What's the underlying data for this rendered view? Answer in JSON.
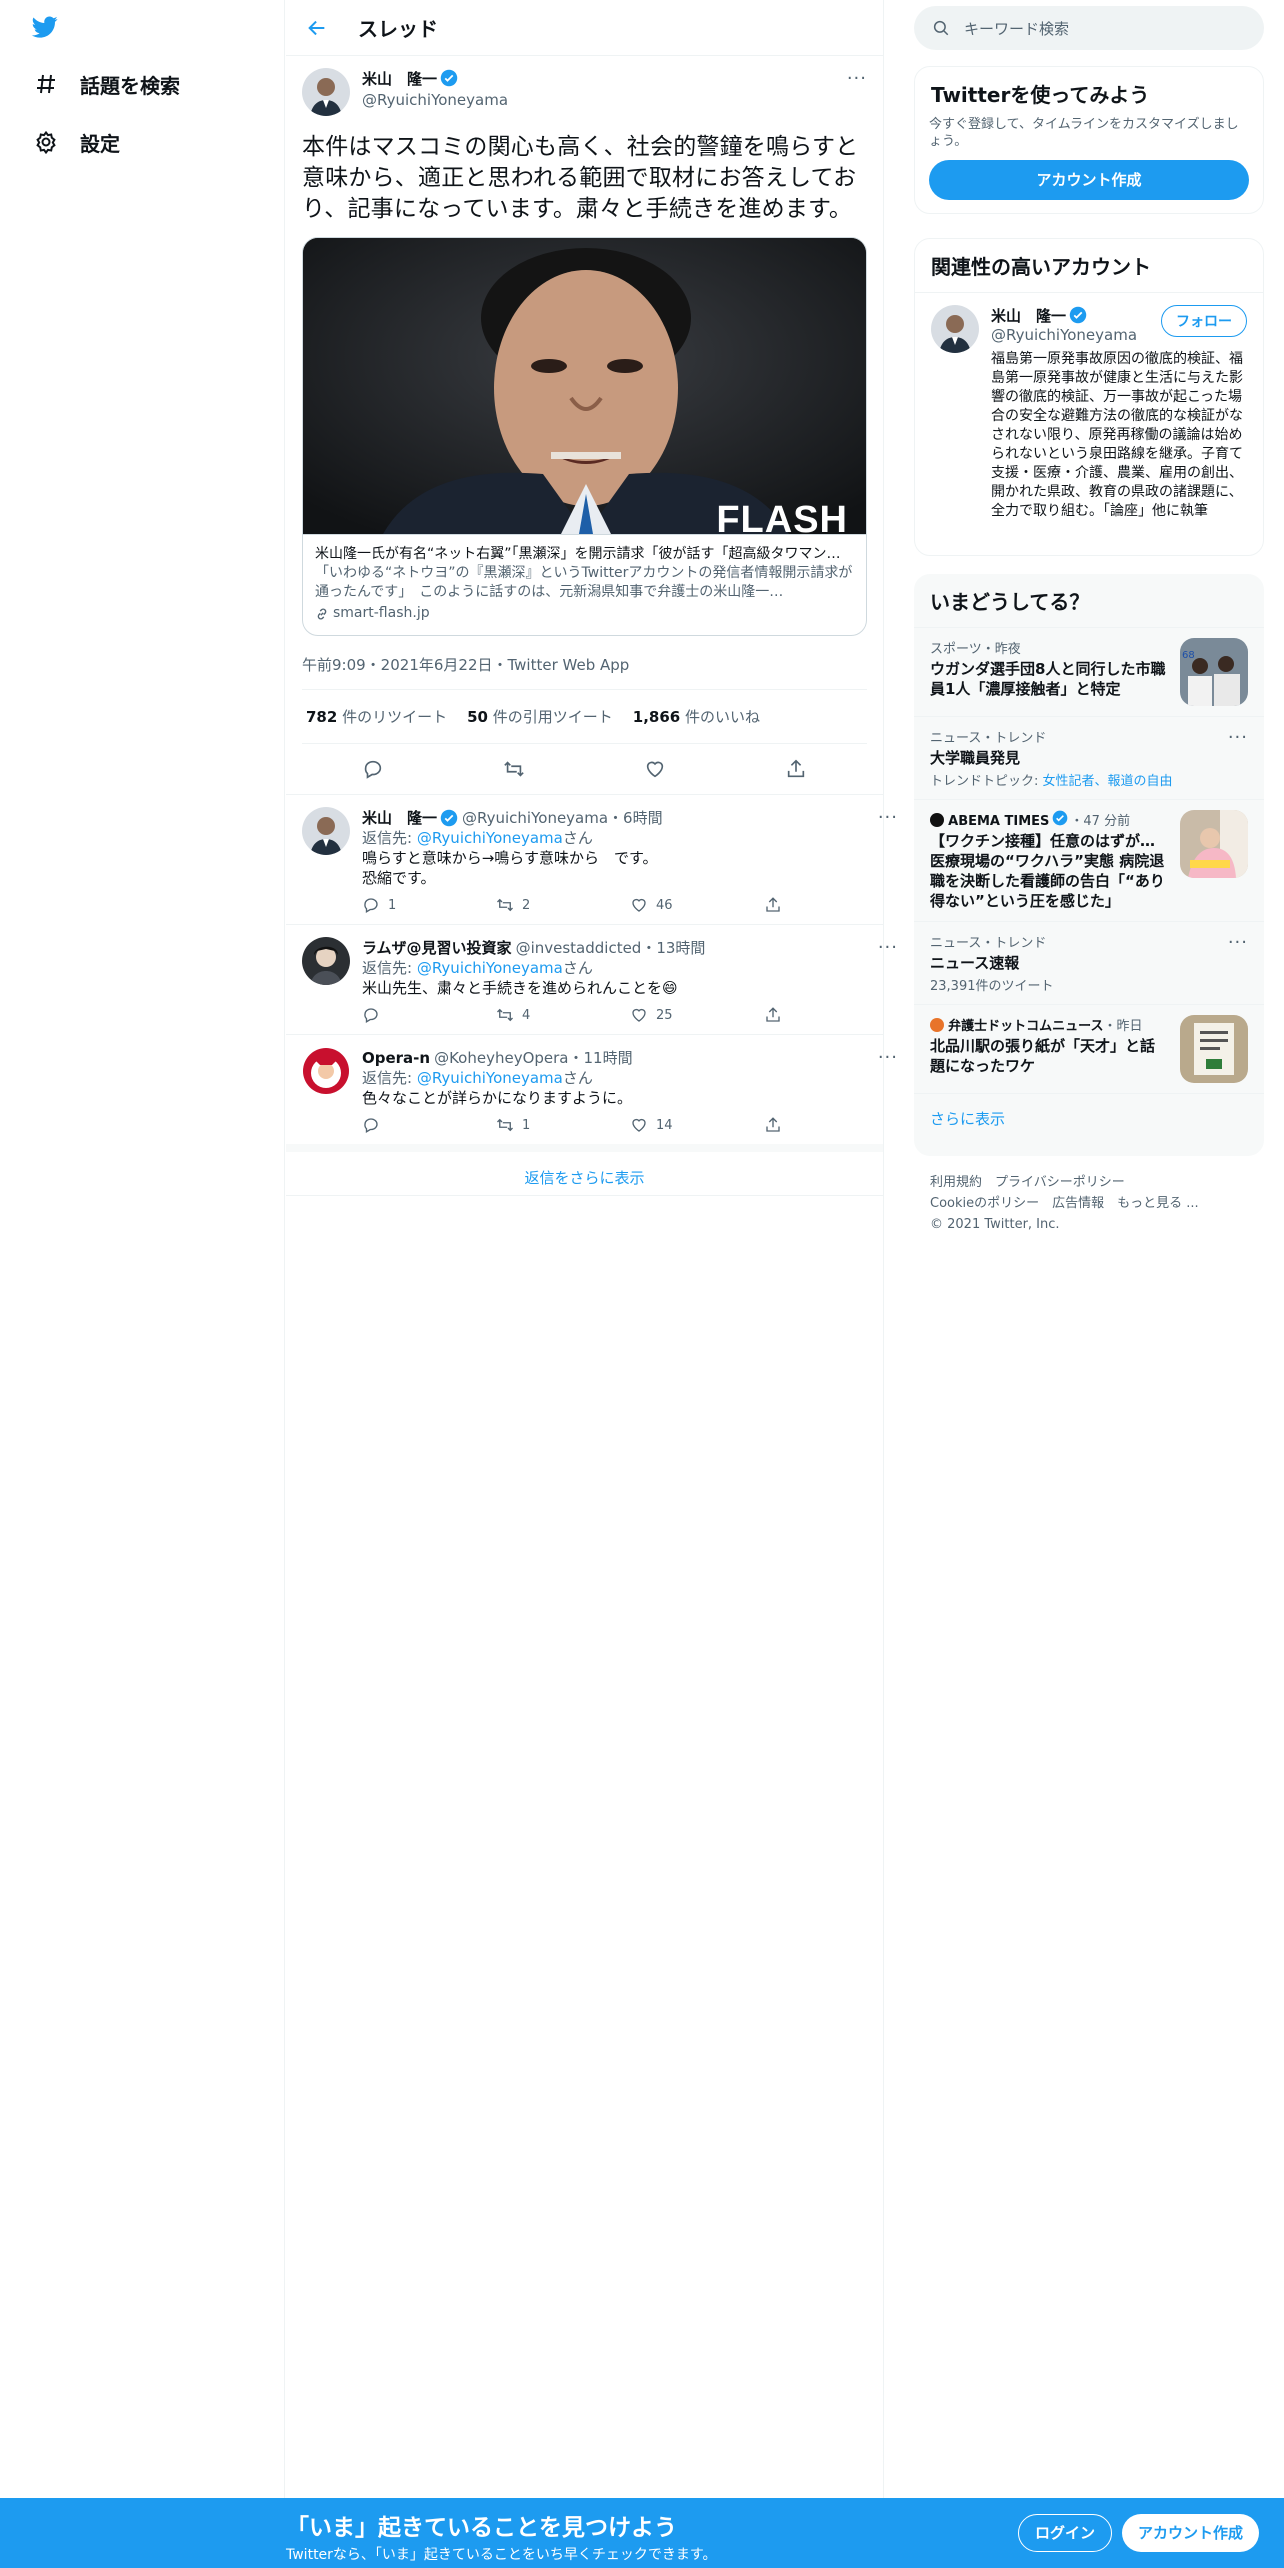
{
  "nav": {
    "explore": "話題を検索",
    "settings": "設定"
  },
  "header": {
    "title": "スレッド"
  },
  "main_tweet": {
    "name": "米山　隆一",
    "handle": "@RyuichiYoneyama",
    "more": "···",
    "text": "本件はマスコミの関心も高く、社会的警鐘を鳴らすと意味から、適正と思われる範囲で取材にお答えしており、記事になっています。粛々と手続きを進めます。",
    "card": {
      "image_label": "FLASH",
      "title": "米山隆一氏が有名“ネット右翼”「黒瀬深」を開示請求「彼が話す「超高級タワマン」と…",
      "description": "「いわゆる“ネトウヨ”の『黒瀬深』というTwitterアカウントの発信者情報開示請求が通ったんです」　このように話すのは、元新潟県知事で弁護士の米山隆一…",
      "domain": "smart-flash.jp"
    },
    "timestamp": "午前9:09・2021年6月22日・Twitter Web App",
    "stats": {
      "retweets": "782",
      "retweets_label": "件のリツイート",
      "quotes": "50",
      "quotes_label": "件の引用ツイート",
      "likes": "1,866",
      "likes_label": "件のいいね"
    }
  },
  "replies": [
    {
      "name": "米山　隆一",
      "meta": "@RyuichiYoneyama・6時間",
      "reply_to_prefix": "返信先: ",
      "reply_to": "@RyuichiYoneyama",
      "reply_to_suffix": "さん",
      "line1": "鳴らすと意味から→鳴らす意味から　です。",
      "line2": "恐縮です。",
      "replies": "1",
      "retweets": "2",
      "likes": "46"
    },
    {
      "name": "ラムザ@見習い投資家",
      "meta": "@investaddicted・13時間",
      "reply_to_prefix": "返信先: ",
      "reply_to": "@RyuichiYoneyama",
      "reply_to_suffix": "さん",
      "line1": "米山先生、粛々と手続きを進められんことを😄",
      "replies": "",
      "retweets": "4",
      "likes": "25"
    },
    {
      "name": "Opera-n",
      "meta": "@KoheyheyOpera・11時間",
      "reply_to_prefix": "返信先: ",
      "reply_to": "@RyuichiYoneyama",
      "reply_to_suffix": "さん",
      "line1": "色々なことが詳らかになりますように。",
      "replies": "",
      "retweets": "1",
      "likes": "14"
    }
  ],
  "show_more_replies": "返信をさらに表示",
  "right": {
    "search_placeholder": "キーワード検索",
    "signup": {
      "title": "Twitterを使ってみよう",
      "desc": "今すぐ登録して、タイムラインをカスタマイズしましょう。",
      "button": "アカウント作成"
    },
    "related": {
      "title": "関連性の高いアカウント",
      "name": "米山　隆一",
      "handle": "@RyuichiYoneyama",
      "follow": "フォロー",
      "bio": "福島第一原発事故原因の徹底的検証、福島第一原発事故が健康と生活に与えた影響の徹底的検証、万一事故が起こった場合の安全な避難方法の徹底的な検証がなされない限り、原発再稼働の議論は始められないという泉田路線を継承。子育て支援・医療・介護、農業、雇用の創出、開かれた県政、教育の県政の諸課題に、全力で取り組む。「論座」他に執筆"
    },
    "trends": {
      "title": "いまどうしてる？",
      "items": [
        {
          "category": "スポーツ・昨夜",
          "name": "ウガンダ選手団8人と同行した市職員1人「濃厚接触者」と特定",
          "thumb_label": "68"
        },
        {
          "category": "ニュース・トレンド",
          "name": "大学職員発見",
          "sub_prefix": "トレンドトピック: ",
          "sub_links": "女性記者、報道の自由",
          "more": "···"
        },
        {
          "category": "ABEMA TIMES",
          "category_suffix": "・47 分前",
          "name": "【ワクチン接種】任意のはずが…医療現場の“ワクハラ”実態 病院退職を決断した看護師の告白「“あり得ない”という圧を感じた」"
        },
        {
          "category": "ニュース・トレンド",
          "name": "ニュース速報",
          "sub": "23,391件のツイート",
          "more": "···"
        },
        {
          "category": "弁護士ドットコムニュース",
          "category_suffix": "・昨日",
          "name": "北品川駅の張り紙が「天才」と話題になったワケ"
        }
      ],
      "show_more": "さらに表示"
    },
    "footer": {
      "line1": "利用規約　プライバシーポリシー",
      "line2": "Cookieのポリシー　広告情報　もっと見る ...",
      "line3": "© 2021 Twitter, Inc."
    }
  },
  "banner": {
    "title": "「いま」起きていることを見つけよう",
    "subtitle": "Twitterなら、「いま」起きていることをいち早くチェックできます。",
    "login": "ログイン",
    "signup": "アカウント作成"
  },
  "colors": {
    "accent": "#1d9bf0",
    "text": "#0f1419",
    "muted": "#536471"
  }
}
